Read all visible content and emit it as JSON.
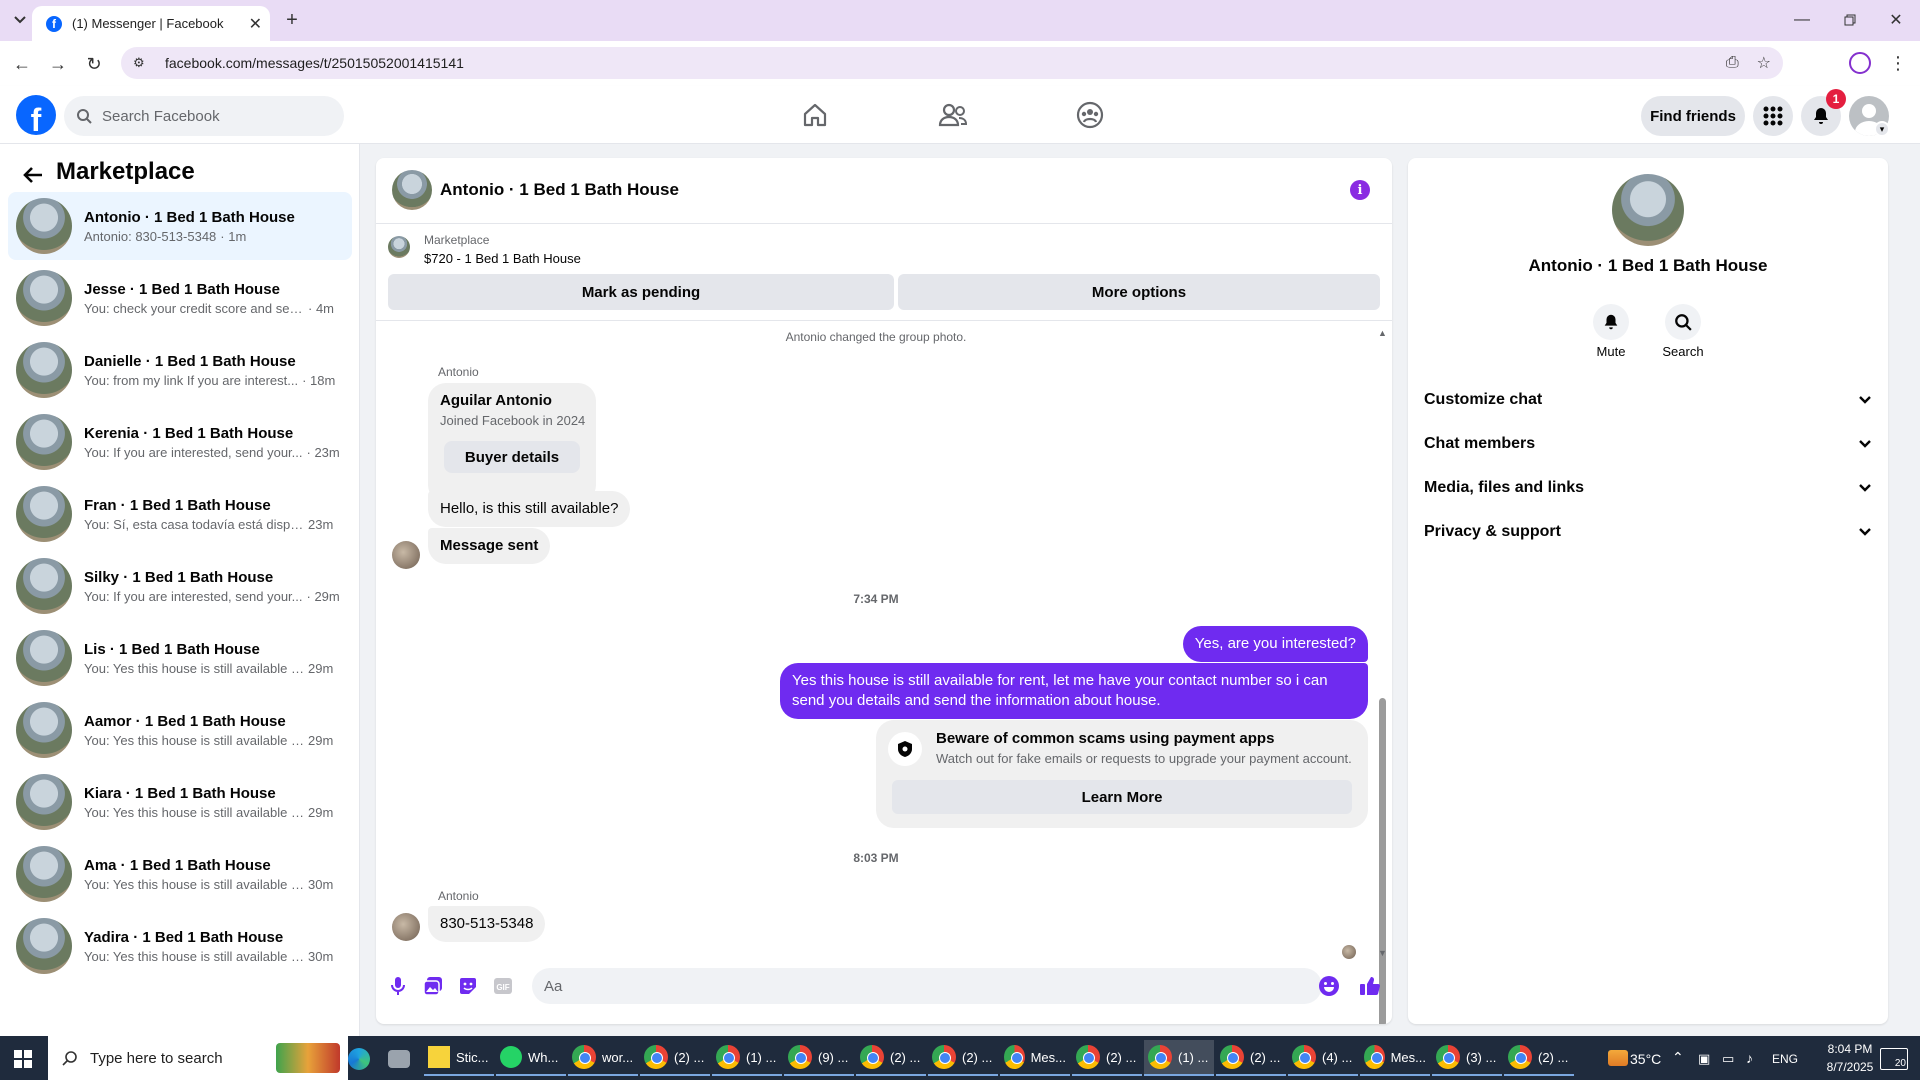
{
  "browser": {
    "tab_title": "(1) Messenger | Facebook",
    "url": "facebook.com/messages/t/25015052001415141"
  },
  "fb": {
    "search_placeholder": "Search Facebook",
    "find_friends": "Find friends",
    "notif_count": "1"
  },
  "left": {
    "title": "Marketplace",
    "conversations": [
      {
        "name": "Antonio · 1 Bed 1 Bath House",
        "preview": "Antonio: 830-513-5348",
        "time": "· 1m"
      },
      {
        "name": "Jesse · 1 Bed 1 Bath House",
        "preview": "You: check your credit score and sen...",
        "time": "· 4m"
      },
      {
        "name": "Danielle · 1 Bed 1 Bath House",
        "preview": "You: from my link If you are interest...",
        "time": "· 18m"
      },
      {
        "name": "Kerenia · 1 Bed 1 Bath House",
        "preview": "You: If you are interested, send your...",
        "time": "· 23m"
      },
      {
        "name": "Fran · 1 Bed 1 Bath House",
        "preview": "You: Sí, esta casa todavía está dispo...",
        "time": "23m"
      },
      {
        "name": "Silky · 1 Bed 1 Bath House",
        "preview": "You: If you are interested, send your...",
        "time": "· 29m"
      },
      {
        "name": "Lis · 1 Bed 1 Bath House",
        "preview": "You: Yes this house is still available f...",
        "time": "29m"
      },
      {
        "name": "Aamor · 1 Bed 1 Bath House",
        "preview": "You: Yes this house is still available f...",
        "time": "29m"
      },
      {
        "name": "Kiara · 1 Bed 1 Bath House",
        "preview": "You: Yes this house is still available f...",
        "time": "29m"
      },
      {
        "name": "Ama · 1 Bed 1 Bath House",
        "preview": "You: Yes this house is still available f...",
        "time": "30m"
      },
      {
        "name": "Yadira · 1 Bed 1 Bath House",
        "preview": "You: Yes this house is still available f...",
        "time": "30m"
      }
    ]
  },
  "chat": {
    "title": "Antonio · 1 Bed 1 Bath House",
    "listing_label": "Marketplace",
    "listing_price": "$720 - 1 Bed 1 Bath House",
    "mark_pending": "Mark as pending",
    "more_options": "More options",
    "system_note": "Antonio changed the group photo.",
    "sender": "Antonio",
    "card_name": "Aguilar Antonio",
    "card_joined": "Joined Facebook in 2024",
    "buyer_details": "Buyer details",
    "msg1": "Hello, is this still available?",
    "msg2": "Message sent",
    "time1": "7:34 PM",
    "out1": "Yes, are you interested?",
    "out2": "Yes this house is still available for rent, let me have your contact number so i can send you details and send the information about house.",
    "scam_title": "Beware of common scams using payment apps",
    "scam_body": "Watch out for fake emails or requests to upgrade your payment account.",
    "learn_more": "Learn More",
    "time2": "8:03 PM",
    "sender2": "Antonio",
    "msg3": "830-513-5348",
    "composer_placeholder": "Aa"
  },
  "right": {
    "title": "Antonio · 1 Bed 1 Bath House",
    "mute": "Mute",
    "search": "Search",
    "sections": [
      "Customize chat",
      "Chat members",
      "Media, files and links",
      "Privacy & support"
    ]
  },
  "taskbar": {
    "search_placeholder": "Type here to search",
    "apps": [
      "Stic...",
      "Wh...",
      "wor...",
      "(2) ...",
      "(1) ...",
      "(9) ...",
      "(2) ...",
      "(2) ...",
      "Mes...",
      "(2) ...",
      "(1) ...",
      "(2) ...",
      "(4) ...",
      "Mes...",
      "(3) ...",
      "(2) ..."
    ],
    "temperature": "35°C",
    "lang": "ENG",
    "time": "8:04 PM",
    "date": "8/7/2025",
    "notif": "20"
  }
}
